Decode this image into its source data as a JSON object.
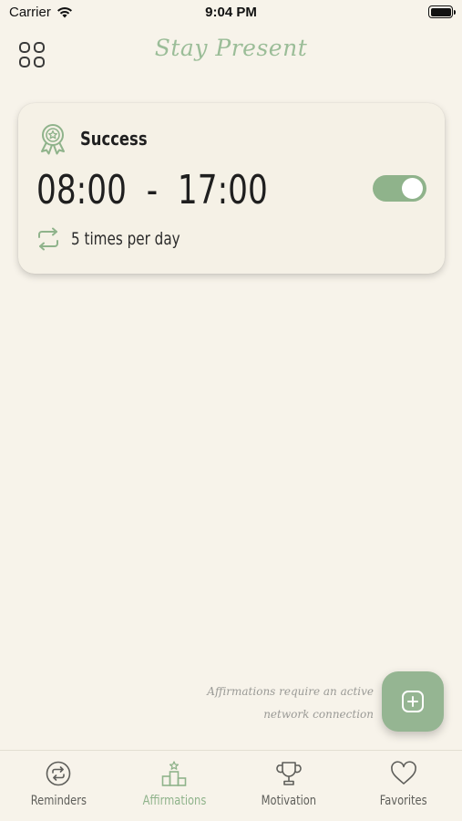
{
  "status_bar": {
    "carrier": "Carrier",
    "time": "9:04 PM"
  },
  "header": {
    "title": "Stay Present",
    "menu_icon": "grid-icon"
  },
  "reminder": {
    "category": "Success",
    "time_range": "08:00  -  17:00",
    "frequency": "5 times per day",
    "enabled": true,
    "icon": "award-icon",
    "frequency_icon": "repeat-icon"
  },
  "note": {
    "line1": "Affirmations require an active",
    "line2": "network connection"
  },
  "fab": {
    "icon": "plus-square-icon"
  },
  "tabs": [
    {
      "label": "Reminders",
      "icon": "refresh-circle-icon",
      "active": false
    },
    {
      "label": "Affirmations",
      "icon": "podium-icon",
      "active": true
    },
    {
      "label": "Motivation",
      "icon": "trophy-icon",
      "active": false
    },
    {
      "label": "Favorites",
      "icon": "heart-icon",
      "active": false
    }
  ],
  "colors": {
    "accent": "#8fb38b",
    "background": "#f7f3ea",
    "card": "#f5f1e6"
  }
}
